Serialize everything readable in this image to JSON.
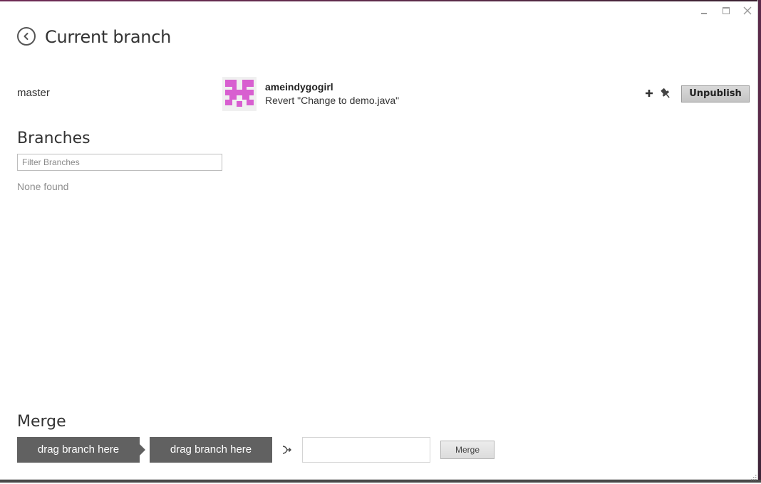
{
  "window": {
    "minimize_label": "_",
    "maximize_label": "□",
    "close_label": "×"
  },
  "header": {
    "title": "Current branch",
    "back_icon": "back-arrow-icon"
  },
  "current_branch": {
    "name": "master",
    "commit": {
      "author": "ameindygogirl",
      "message": "Revert \"Change to demo.java\""
    },
    "actions": {
      "add_icon": "plus-icon",
      "pin_icon": "pin-icon",
      "unpublish_label": "Unpublish"
    }
  },
  "branches": {
    "heading": "Branches",
    "filter_placeholder": "Filter Branches",
    "empty_text": "None found"
  },
  "merge": {
    "heading": "Merge",
    "source_slot": "drag branch here",
    "target_slot": "drag branch here",
    "merge_button": "Merge"
  },
  "colors": {
    "avatar_fg": "#d85fd0",
    "avatar_bg": "#f0f0f0",
    "slot_bg": "#616161",
    "frame_accent": "#5b2a4a"
  }
}
